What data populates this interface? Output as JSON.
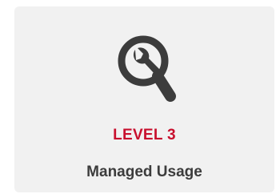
{
  "card": {
    "icon": "magnifier-wrench-icon",
    "level_label": "LEVEL 3",
    "title": "Managed Usage"
  },
  "colors": {
    "card_background": "#f1f1f1",
    "icon": "#3c3c3c",
    "level": "#c8102e",
    "title": "#3c3c3c"
  }
}
